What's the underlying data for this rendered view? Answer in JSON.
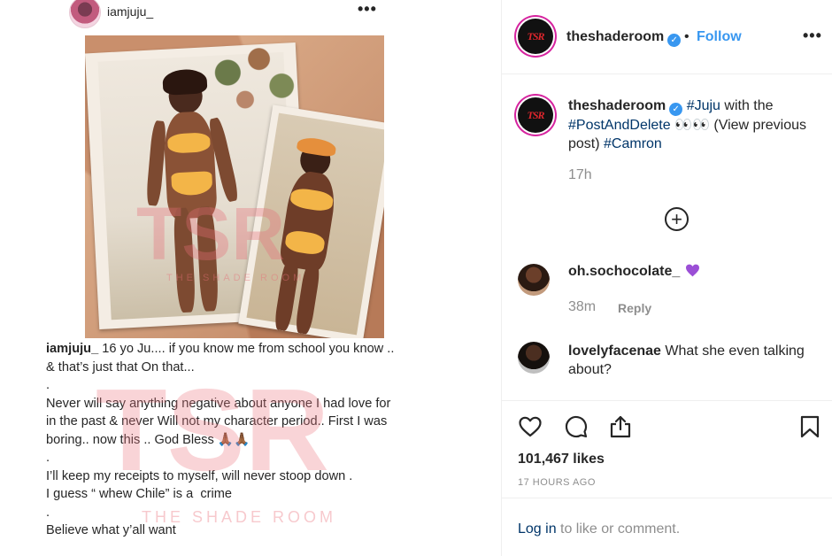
{
  "left_post": {
    "username": "iamjuju_",
    "more_label": "•••",
    "caption_user": "iamjuju_",
    "caption_lines": [
      " 16 yo Ju.... if you know me from school you know .. & that’s just that On that...",
      ".",
      "",
      "Never will say anything negative about anyone I had love for in the past & never Will not my character period.. First I was boring.. now this .. God Bless 🙏🏾🙏🏾",
      ".",
      "I’ll keep my receipts to myself, will never stoop down .",
      "I guess “ whew Chile” is a  crime",
      ".",
      "Believe what y’all want"
    ],
    "watermark_logo": "TSR",
    "watermark_text": "THE SHADE ROOM"
  },
  "header": {
    "avatar_text": "TSR",
    "username": "theshaderoom",
    "verified_mark": "✓",
    "separator": "•",
    "follow_label": "Follow",
    "more_label": "•••"
  },
  "caption": {
    "username": "theshaderoom",
    "tag_juju": "#Juju",
    "text_with": " with the ",
    "tag_post": "#PostAndDelete",
    "text_mid": " 👀👀 (View previous post) ",
    "tag_camron": "#Camron",
    "time": "17h"
  },
  "load_more_symbol": "+",
  "comments": [
    {
      "username": "oh.sochocolate_",
      "text": "",
      "time": "38m",
      "reply_label": "Reply"
    },
    {
      "username": "lovelyfacenae",
      "text": " What she even talking about?"
    }
  ],
  "actions": {
    "icons": [
      "heart-icon",
      "comment-icon",
      "share-icon",
      "bookmark-icon"
    ],
    "likes": "101,467 likes",
    "posted_ago": "17 HOURS AGO"
  },
  "login": {
    "link_label": "Log in",
    "rest_text": "to like or comment."
  },
  "colors": {
    "accent_blue": "#3897f0",
    "tag_blue": "#003569",
    "muted": "#8e8e8e",
    "tsr_red": "#e0262d",
    "watermark_pink": "#e66e78"
  }
}
